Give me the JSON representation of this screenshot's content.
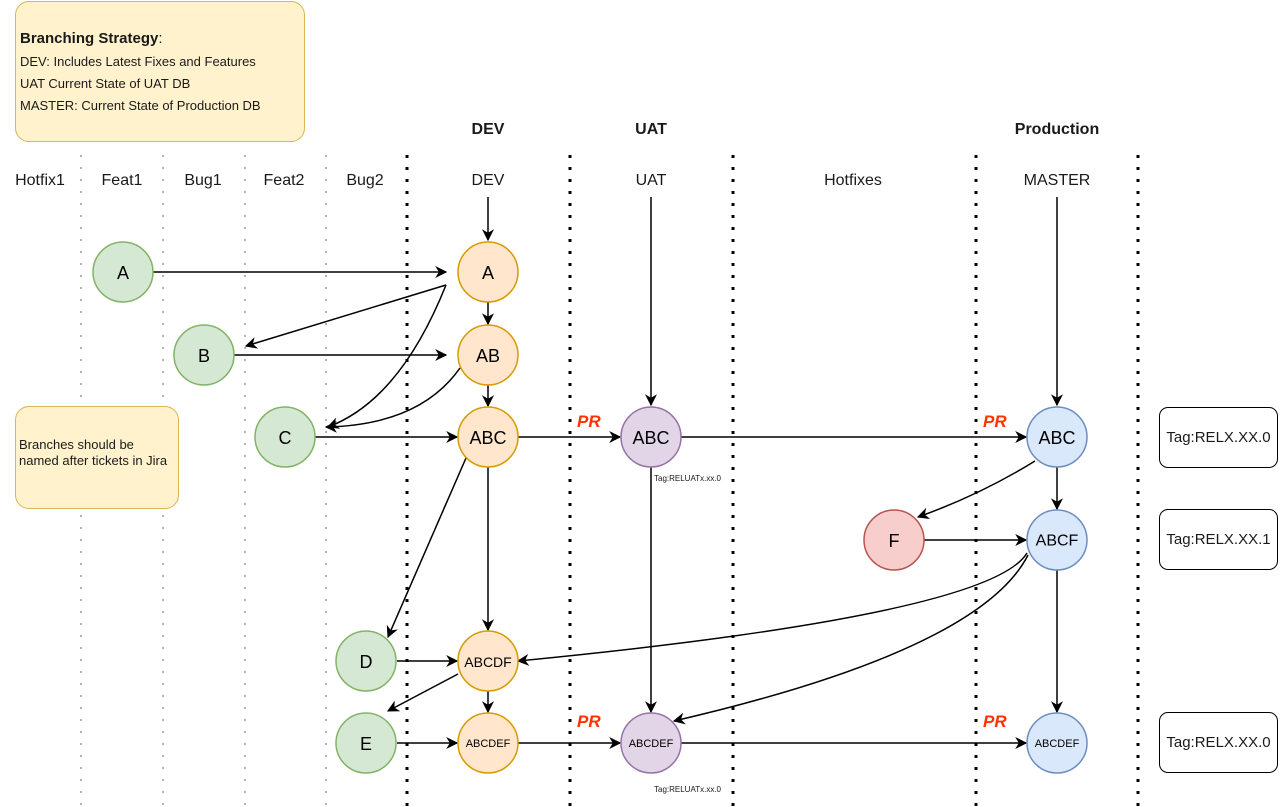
{
  "strategy_note": {
    "title": "Branching Strategy",
    "title_suffix": ":",
    "lines": [
      "DEV: Includes Latest Fixes and Features",
      "UAT Current State of UAT DB",
      "MASTER: Current State of Production DB"
    ]
  },
  "naming_note": {
    "text": "Branches should be named after tickets in Jira"
  },
  "environment_headers": {
    "dev": "DEV",
    "uat": "UAT",
    "production": "Production"
  },
  "lanes": {
    "hotfix1": "Hotfix1",
    "feat1": "Feat1",
    "bug1": "Bug1",
    "feat2": "Feat2",
    "bug2": "Bug2",
    "dev": "DEV",
    "uat": "UAT",
    "hotfixes": "Hotfixes",
    "master": "MASTER"
  },
  "nodes": {
    "feat1_a": "A",
    "bug1_b": "B",
    "feat2_c": "C",
    "bug2_d": "D",
    "bug2_e": "E",
    "dev_a": "A",
    "dev_ab": "AB",
    "dev_abc": "ABC",
    "dev_abcdf": "ABCDF",
    "dev_abcdef": "ABCDEF",
    "uat_abc": "ABC",
    "uat_abcdef": "ABCDEF",
    "hotfix_f": "F",
    "master_abc": "ABC",
    "master_abcf": "ABCF",
    "master_abcdef": "ABCDEF"
  },
  "pr_label": "PR",
  "uat_tags": [
    "Tag:RELUATx.xx.0",
    "Tag:RELUATx.xx.0"
  ],
  "release_tags": [
    "Tag:RELX.XX.0",
    "Tag:RELX.XX.1",
    "Tag:RELX.XX.0"
  ],
  "colors": {
    "feature_fill": "#d5e8d4",
    "feature_stroke": "#82b366",
    "dev_fill": "#ffe6cc",
    "dev_stroke": "#d79b00",
    "uat_fill": "#e1d5e7",
    "uat_stroke": "#9673a6",
    "master_fill": "#dae8fc",
    "master_stroke": "#6c8ebf",
    "hotfix_fill": "#f8cecc",
    "hotfix_stroke": "#b85450",
    "pr_text": "#ff3300",
    "note_fill": "#fff2cc",
    "note_stroke": "#d6b656"
  }
}
